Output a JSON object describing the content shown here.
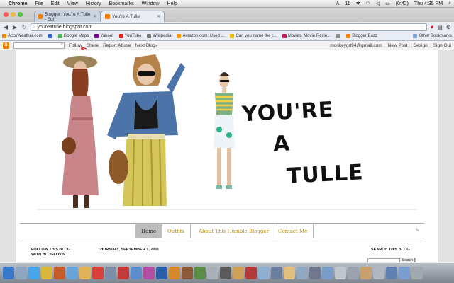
{
  "menubar": {
    "apple": "",
    "app": "Chrome",
    "items": [
      "File",
      "Edit",
      "View",
      "History",
      "Bookmarks",
      "Window",
      "Help"
    ],
    "status": [
      "11",
      "(0:42)",
      "Thu 4:35 PM"
    ]
  },
  "tabs": [
    {
      "title": "Blogger: You're A Tulle - Edi"
    },
    {
      "title": "You're A Tulle"
    }
  ],
  "address": {
    "url": "youreatulle.blogspot.com"
  },
  "bookmarks": [
    {
      "label": "AccuWeather.com",
      "color": "#f08a00"
    },
    {
      "label": "",
      "color": "#3366cc"
    },
    {
      "label": "Google Maps",
      "color": "#4caf50"
    },
    {
      "label": "Yahoo!",
      "color": "#7b0099"
    },
    {
      "label": "YouTube",
      "color": "#e62117"
    },
    {
      "label": "Wikipedia",
      "color": "#777777"
    },
    {
      "label": "Amazon.com: Used ...",
      "color": "#ff9900"
    },
    {
      "label": "Can you name the t...",
      "color": "#e5b800"
    },
    {
      "label": "Movies, Movie Revie...",
      "color": "#c2185b"
    },
    {
      "label": "",
      "color": "#888888"
    },
    {
      "label": "Blogger Buzz",
      "color": "#f57d00"
    }
  ],
  "bookmarks_other": "Other Bookmarks",
  "blogger_nav": {
    "links": [
      "Follow",
      "Share",
      "Report Abuse",
      "Next Blog»"
    ],
    "right": [
      "monkeygrl94@gmail.com",
      "New Post",
      "Design",
      "Sign Out"
    ]
  },
  "blog": {
    "title_line1": "YOU'RE",
    "title_line2": "A",
    "title_line3": "TULLE",
    "nav": [
      "Home",
      "Outfits",
      "About This Humble Blogger",
      "Contact Me"
    ],
    "follow_heading_1": "FOLLOW THIS BLOG",
    "follow_heading_2": "WITH BLOGLOVIN",
    "post_date": "THURSDAY, SEPTEMBER 1, 2011",
    "search_heading": "SEARCH THIS BLOG",
    "search_button": "Search"
  },
  "colors": {
    "accent": "#b8860b",
    "blogger": "#f57d00"
  }
}
